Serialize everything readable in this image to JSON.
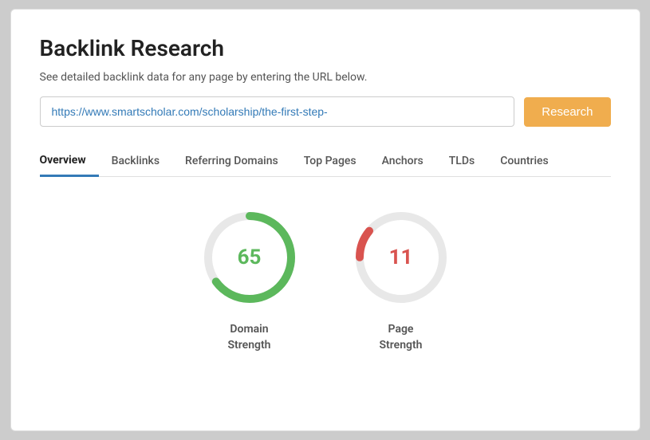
{
  "page": {
    "title": "Backlink Research",
    "subtitle": "See detailed backlink data for any page by entering the URL below.",
    "url_value": "https://www.smartscholar.com/scholarship/the-first-step-",
    "url_placeholder": "Enter URL",
    "research_button": "Research"
  },
  "tabs": [
    {
      "id": "overview",
      "label": "Overview",
      "active": true
    },
    {
      "id": "backlinks",
      "label": "Backlinks",
      "active": false
    },
    {
      "id": "referring-domains",
      "label": "Referring Domains",
      "active": false
    },
    {
      "id": "top-pages",
      "label": "Top Pages",
      "active": false
    },
    {
      "id": "anchors",
      "label": "Anchors",
      "active": false
    },
    {
      "id": "tlds",
      "label": "TLDs",
      "active": false
    },
    {
      "id": "countries",
      "label": "Countries",
      "active": false
    }
  ],
  "metrics": [
    {
      "id": "domain-strength",
      "value": "65",
      "label": "Domain\nStrength",
      "color_class": "green",
      "stroke_color": "#5cb85c",
      "percent": 65
    },
    {
      "id": "page-strength",
      "value": "11",
      "label": "Page\nStrength",
      "color_class": "red",
      "stroke_color": "#d9534f",
      "percent": 11
    }
  ]
}
